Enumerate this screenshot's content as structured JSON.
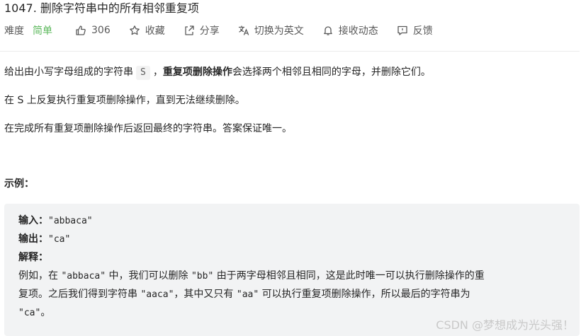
{
  "problem": {
    "title": "1047. 删除字符串中的所有相邻重复项"
  },
  "toolbar": {
    "difficulty_label": "难度",
    "difficulty_value": "简单",
    "difficulty_color": "#5cb85c",
    "like_count": "306",
    "favorite_label": "收藏",
    "share_label": "分享",
    "translate_label": "切换为英文",
    "notify_label": "接收动态",
    "feedback_label": "反馈",
    "icons": [
      "thumbs-up-icon",
      "star-icon",
      "share-icon",
      "translate-icon",
      "bell-icon",
      "feedback-icon"
    ]
  },
  "description": {
    "p1_before": "给出由小写字母组成的字符串",
    "p1_code": "S",
    "p1_comma": "，",
    "p1_bold": "重复项删除操作",
    "p1_after": "会选择两个相邻且相同的字母，并删除它们。",
    "p2": "在 S 上反复执行重复项删除操作，直到无法继续删除。",
    "p3": "在完成所有重复项删除操作后返回最终的字符串。答案保证唯一。"
  },
  "example": {
    "heading": "示例：",
    "input_label": "输入：",
    "input_value": "\"abbaca\"",
    "output_label": "输出：",
    "output_value": "\"ca\"",
    "explain_label": "解释：",
    "explain_l1_a": "例如，在 ",
    "explain_l1_code1": "\"abbaca\"",
    "explain_l1_b": " 中，我们可以删除 ",
    "explain_l1_code2": "\"bb\"",
    "explain_l1_c": " 由于两字母相邻且相同，这是此时唯一可以执行删除操作的重",
    "explain_l2_a": "复项。之后我们得到字符串 ",
    "explain_l2_code1": "\"aaca\"",
    "explain_l2_b": "，其中又只有 ",
    "explain_l2_code2": "\"aa\"",
    "explain_l2_c": " 可以执行重复项删除操作，所以最后的字符串为",
    "explain_l3_code": "\"ca\"",
    "explain_l3_end": "。"
  },
  "watermark": {
    "text": "CSDN @梦想成为光头强！"
  }
}
